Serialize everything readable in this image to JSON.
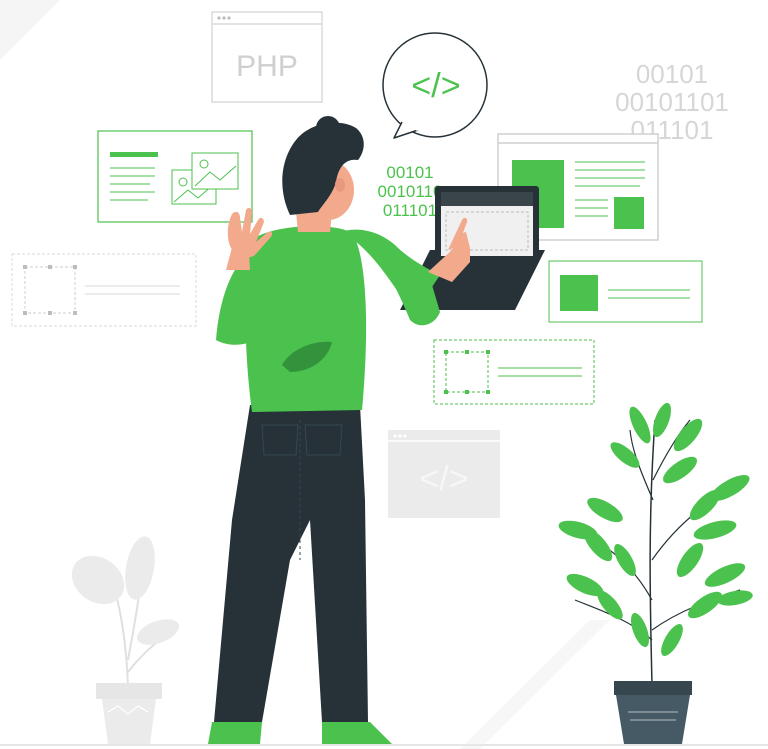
{
  "labels": {
    "php": "PHP",
    "code_tag": "</>",
    "code_tag_gray": "</>"
  },
  "binary_gray": [
    "00101",
    "00101101",
    "011101"
  ],
  "binary_green": [
    "00101",
    "0010110",
    "011101"
  ],
  "colors": {
    "accent_green": "#4CC24E",
    "dark_green": "#2E8B3A",
    "dark_navy": "#263238",
    "skin": "#F2A98C",
    "light_gray": "#E6E6E6",
    "mid_gray": "#CFCFCF"
  }
}
